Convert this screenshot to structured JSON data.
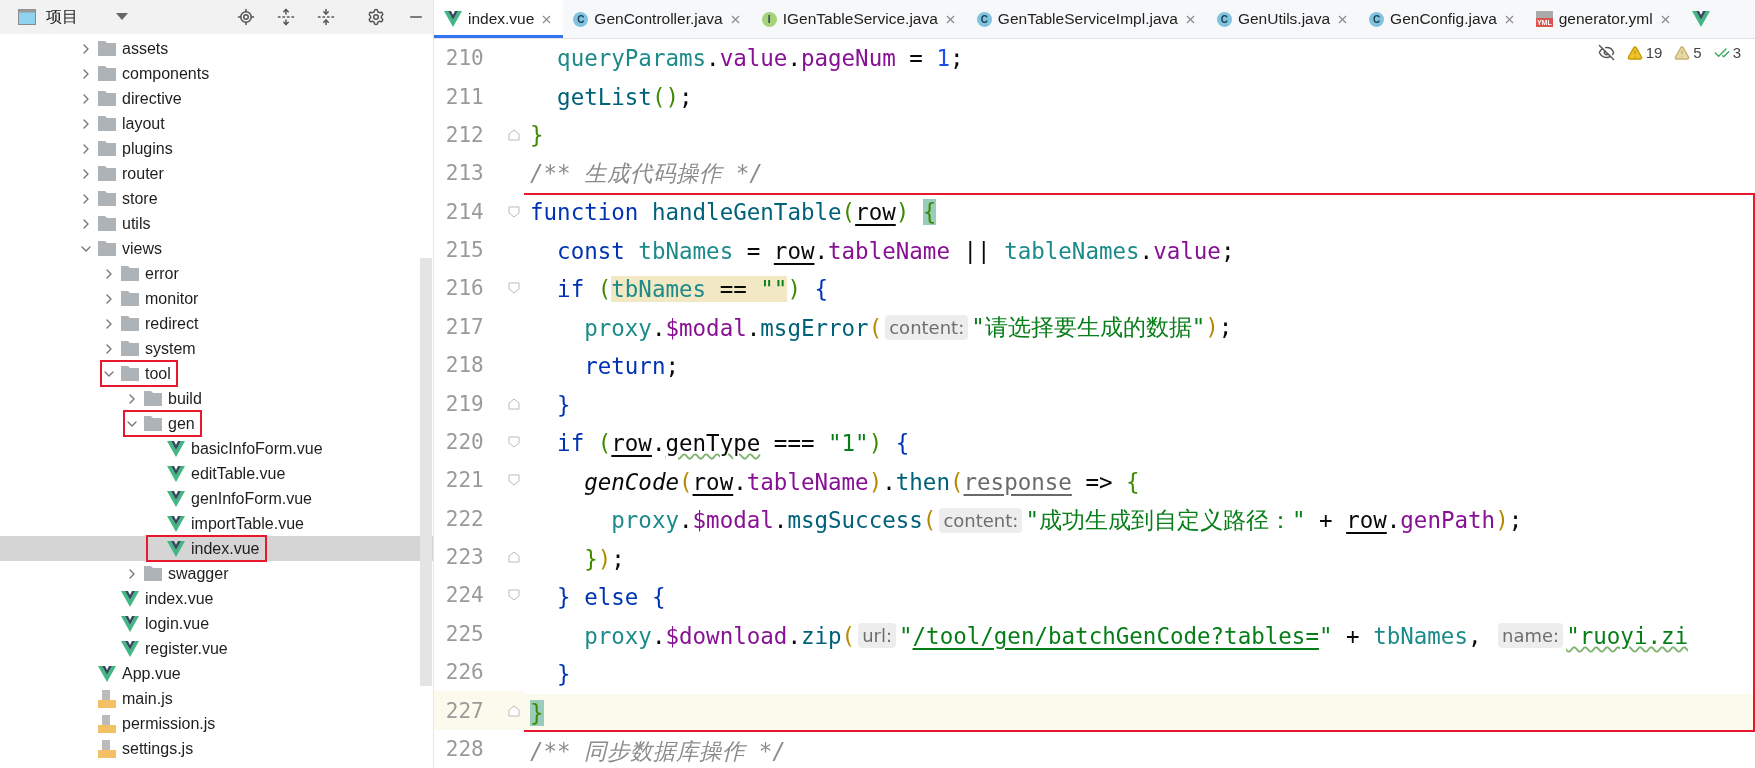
{
  "project_panel": {
    "title": "项目",
    "tree": [
      {
        "label": "assets",
        "kind": "folder",
        "expanded": false,
        "selected": false,
        "boxed": false
      },
      {
        "label": "components",
        "kind": "folder",
        "expanded": false,
        "selected": false,
        "boxed": false
      },
      {
        "label": "directive",
        "kind": "folder",
        "expanded": false,
        "selected": false,
        "boxed": false
      },
      {
        "label": "layout",
        "kind": "folder",
        "expanded": false,
        "selected": false,
        "boxed": false
      },
      {
        "label": "plugins",
        "kind": "folder",
        "expanded": false,
        "selected": false,
        "boxed": false
      },
      {
        "label": "router",
        "kind": "folder",
        "expanded": false,
        "selected": false,
        "boxed": false
      },
      {
        "label": "store",
        "kind": "folder",
        "expanded": false,
        "selected": false,
        "boxed": false
      },
      {
        "label": "utils",
        "kind": "folder",
        "expanded": false,
        "selected": false,
        "boxed": false
      },
      {
        "label": "views",
        "kind": "folder",
        "expanded": true,
        "selected": false,
        "boxed": false,
        "children": [
          {
            "label": "error",
            "kind": "folder",
            "expanded": false,
            "selected": false,
            "boxed": false
          },
          {
            "label": "monitor",
            "kind": "folder",
            "expanded": false,
            "selected": false,
            "boxed": false
          },
          {
            "label": "redirect",
            "kind": "folder",
            "expanded": false,
            "selected": false,
            "boxed": false
          },
          {
            "label": "system",
            "kind": "folder",
            "expanded": false,
            "selected": false,
            "boxed": false
          },
          {
            "label": "tool",
            "kind": "folder",
            "expanded": true,
            "selected": false,
            "boxed": true,
            "children": [
              {
                "label": "build",
                "kind": "folder",
                "expanded": false,
                "selected": false,
                "boxed": false
              },
              {
                "label": "gen",
                "kind": "folder",
                "expanded": true,
                "selected": false,
                "boxed": true,
                "children": [
                  {
                    "label": "basicInfoForm.vue",
                    "kind": "vue",
                    "selected": false,
                    "boxed": false
                  },
                  {
                    "label": "editTable.vue",
                    "kind": "vue",
                    "selected": false,
                    "boxed": false
                  },
                  {
                    "label": "genInfoForm.vue",
                    "kind": "vue",
                    "selected": false,
                    "boxed": false
                  },
                  {
                    "label": "importTable.vue",
                    "kind": "vue",
                    "selected": false,
                    "boxed": false
                  },
                  {
                    "label": "index.vue",
                    "kind": "vue",
                    "selected": true,
                    "boxed": true
                  }
                ]
              },
              {
                "label": "swagger",
                "kind": "folder",
                "expanded": false,
                "selected": false,
                "boxed": false
              }
            ]
          },
          {
            "label": "index.vue",
            "kind": "vue",
            "selected": false,
            "boxed": false
          },
          {
            "label": "login.vue",
            "kind": "vue",
            "selected": false,
            "boxed": false
          },
          {
            "label": "register.vue",
            "kind": "vue",
            "selected": false,
            "boxed": false
          }
        ]
      },
      {
        "label": "App.vue",
        "kind": "vue",
        "selected": false,
        "boxed": false
      },
      {
        "label": "main.js",
        "kind": "js",
        "selected": false,
        "boxed": false
      },
      {
        "label": "permission.js",
        "kind": "js",
        "selected": false,
        "boxed": false
      },
      {
        "label": "settings.js",
        "kind": "js",
        "selected": false,
        "boxed": false
      }
    ]
  },
  "editor": {
    "tabs": [
      {
        "label": "index.vue",
        "kind": "vue",
        "selected": true
      },
      {
        "label": "GenController.java",
        "kind": "class",
        "badge": "C",
        "selected": false
      },
      {
        "label": "IGenTableService.java",
        "kind": "interface",
        "badge": "I",
        "selected": false
      },
      {
        "label": "GenTableServiceImpl.java",
        "kind": "class",
        "badge": "C",
        "selected": false
      },
      {
        "label": "GenUtils.java",
        "kind": "class",
        "badge": "C",
        "selected": false
      },
      {
        "label": "GenConfig.java",
        "kind": "class",
        "badge": "C",
        "selected": false
      },
      {
        "label": "generator.yml",
        "kind": "yml",
        "badge": "YML",
        "selected": false
      },
      {
        "kind": "vue",
        "selected": false
      }
    ],
    "inspections": [
      {
        "kind": "warning",
        "count": "19"
      },
      {
        "kind": "weak",
        "count": "5"
      },
      {
        "kind": "typo",
        "count": "3"
      }
    ],
    "code_blocks": [
      {
        "boxed": false,
        "lines": [
          {
            "number": "210",
            "current": false,
            "fold_start": false,
            "fold_end": false,
            "tokens": [
              {
                "text": "  queryParams",
                "kind": "var"
              },
              {
                "text": ".",
                "kind": "plain"
              },
              {
                "text": "value",
                "kind": "prop"
              },
              {
                "text": ".",
                "kind": "plain"
              },
              {
                "text": "pageNum",
                "kind": "prop"
              },
              {
                "text": " = ",
                "kind": "plain"
              },
              {
                "text": "1",
                "kind": "number"
              },
              {
                "text": ";",
                "kind": "plain"
              }
            ]
          },
          {
            "number": "211",
            "current": false,
            "fold_start": false,
            "fold_end": false,
            "tokens": [
              {
                "text": "  getList",
                "kind": "func"
              },
              {
                "text": "()",
                "kind": "bracket1"
              },
              {
                "text": ";",
                "kind": "plain"
              }
            ]
          },
          {
            "number": "212",
            "current": false,
            "fold_start": false,
            "fold_end": true,
            "tokens": [
              {
                "text": "}",
                "kind": "bracket1"
              }
            ]
          },
          {
            "number": "213",
            "current": false,
            "fold_start": false,
            "fold_end": false,
            "tokens": [
              {
                "text": "/** 生成代码操作 */",
                "kind": "comment"
              }
            ]
          }
        ]
      },
      {
        "boxed": true,
        "lines": [
          {
            "number": "214",
            "current": false,
            "fold_start": true,
            "fold_end": false,
            "tokens": [
              {
                "text": "function",
                "kind": "keyword"
              },
              {
                "text": " handleGenTable",
                "kind": "func"
              },
              {
                "text": "(",
                "kind": "bracket1"
              },
              {
                "text": "row",
                "kind": "plain",
                "underlined": true
              },
              {
                "text": ") ",
                "kind": "bracket1"
              },
              {
                "text": "{",
                "kind": "bracket1",
                "brace_match": true
              }
            ]
          },
          {
            "number": "215",
            "current": false,
            "fold_start": false,
            "fold_end": false,
            "tokens": [
              {
                "text": "  const",
                "kind": "keyword"
              },
              {
                "text": " tbNames",
                "kind": "var"
              },
              {
                "text": " = ",
                "kind": "plain"
              },
              {
                "text": "row",
                "kind": "plain",
                "underlined": true
              },
              {
                "text": ".",
                "kind": "plain"
              },
              {
                "text": "tableName",
                "kind": "prop"
              },
              {
                "text": " || ",
                "kind": "plain"
              },
              {
                "text": "tableNames",
                "kind": "var"
              },
              {
                "text": ".",
                "kind": "plain"
              },
              {
                "text": "value",
                "kind": "prop"
              },
              {
                "text": ";",
                "kind": "plain"
              }
            ]
          },
          {
            "number": "216",
            "current": false,
            "fold_start": true,
            "fold_end": false,
            "tokens": [
              {
                "text": "  if",
                "kind": "keyword"
              },
              {
                "text": " (",
                "kind": "bracket1"
              },
              {
                "text": "tbNames",
                "kind": "var",
                "usage_highlight": true
              },
              {
                "text": " == ",
                "kind": "plain",
                "usage_highlight": true
              },
              {
                "text": "\"\"",
                "kind": "string",
                "usage_highlight": true
              },
              {
                "text": ")",
                "kind": "bracket1"
              },
              {
                "text": " {",
                "kind": "bracket3"
              }
            ]
          },
          {
            "number": "217",
            "current": false,
            "fold_start": false,
            "fold_end": false,
            "tokens": [
              {
                "text": "    proxy",
                "kind": "var"
              },
              {
                "text": ".",
                "kind": "plain"
              },
              {
                "text": "$modal",
                "kind": "prop"
              },
              {
                "text": ".",
                "kind": "plain"
              },
              {
                "text": "msgError",
                "kind": "func"
              },
              {
                "text": "(",
                "kind": "bracket2"
              },
              {
                "text": "content:",
                "kind": "hint"
              },
              {
                "text": "\"请选择要生成的数据\"",
                "kind": "string"
              },
              {
                "text": ")",
                "kind": "bracket2"
              },
              {
                "text": ";",
                "kind": "plain"
              }
            ]
          },
          {
            "number": "218",
            "current": false,
            "fold_start": false,
            "fold_end": false,
            "tokens": [
              {
                "text": "    return",
                "kind": "keyword"
              },
              {
                "text": ";",
                "kind": "plain"
              }
            ]
          },
          {
            "number": "219",
            "current": false,
            "fold_start": false,
            "fold_end": true,
            "tokens": [
              {
                "text": "  }",
                "kind": "bracket3"
              }
            ]
          },
          {
            "number": "220",
            "current": false,
            "fold_start": true,
            "fold_end": false,
            "tokens": [
              {
                "text": "  if",
                "kind": "keyword"
              },
              {
                "text": " (",
                "kind": "bracket1"
              },
              {
                "text": "row",
                "kind": "plain",
                "underlined": true
              },
              {
                "text": ".",
                "kind": "plain"
              },
              {
                "text": "genType",
                "kind": "plain",
                "wavy": true
              },
              {
                "text": " === ",
                "kind": "plain"
              },
              {
                "text": "\"1\"",
                "kind": "string"
              },
              {
                "text": ")",
                "kind": "bracket1"
              },
              {
                "text": " {",
                "kind": "bracket3"
              }
            ]
          },
          {
            "number": "221",
            "current": false,
            "fold_start": true,
            "fold_end": false,
            "tokens": [
              {
                "text": "    genCode",
                "kind": "imported"
              },
              {
                "text": "(",
                "kind": "bracket2"
              },
              {
                "text": "row",
                "kind": "plain",
                "underlined": true
              },
              {
                "text": ".",
                "kind": "plain"
              },
              {
                "text": "tableName",
                "kind": "prop"
              },
              {
                "text": ")",
                "kind": "bracket2"
              },
              {
                "text": ".",
                "kind": "plain"
              },
              {
                "text": "then",
                "kind": "func"
              },
              {
                "text": "(",
                "kind": "bracket2"
              },
              {
                "text": "response",
                "kind": "unused",
                "underlined": true
              },
              {
                "text": " => ",
                "kind": "plain"
              },
              {
                "text": "{",
                "kind": "bracket1"
              }
            ]
          },
          {
            "number": "222",
            "current": false,
            "fold_start": false,
            "fold_end": false,
            "tokens": [
              {
                "text": "      proxy",
                "kind": "var"
              },
              {
                "text": ".",
                "kind": "plain"
              },
              {
                "text": "$modal",
                "kind": "prop"
              },
              {
                "text": ".",
                "kind": "plain"
              },
              {
                "text": "msgSuccess",
                "kind": "func"
              },
              {
                "text": "(",
                "kind": "bracket2"
              },
              {
                "text": "content:",
                "kind": "hint"
              },
              {
                "text": "\"成功生成到自定义路径：\"",
                "kind": "string"
              },
              {
                "text": " + ",
                "kind": "plain"
              },
              {
                "text": "row",
                "kind": "plain",
                "underlined": true
              },
              {
                "text": ".",
                "kind": "plain"
              },
              {
                "text": "genPath",
                "kind": "prop"
              },
              {
                "text": ")",
                "kind": "bracket2"
              },
              {
                "text": ";",
                "kind": "plain"
              }
            ]
          },
          {
            "number": "223",
            "current": false,
            "fold_start": false,
            "fold_end": true,
            "tokens": [
              {
                "text": "    }",
                "kind": "bracket1"
              },
              {
                "text": ")",
                "kind": "bracket2"
              },
              {
                "text": ";",
                "kind": "plain"
              }
            ]
          },
          {
            "number": "224",
            "current": false,
            "fold_start": true,
            "fold_end": false,
            "tokens": [
              {
                "text": "  }",
                "kind": "bracket3"
              },
              {
                "text": " else",
                "kind": "keyword"
              },
              {
                "text": " {",
                "kind": "bracket3"
              }
            ]
          },
          {
            "number": "225",
            "current": false,
            "fold_start": false,
            "fold_end": false,
            "tokens": [
              {
                "text": "    proxy",
                "kind": "var"
              },
              {
                "text": ".",
                "kind": "plain"
              },
              {
                "text": "$download",
                "kind": "prop"
              },
              {
                "text": ".",
                "kind": "plain"
              },
              {
                "text": "zip",
                "kind": "func"
              },
              {
                "text": "(",
                "kind": "bracket2"
              },
              {
                "text": "url:",
                "kind": "hint"
              },
              {
                "text": "\"",
                "kind": "string"
              },
              {
                "text": "/tool/gen/batchGenCode?tables=",
                "kind": "string",
                "underlined": true
              },
              {
                "text": "\"",
                "kind": "string"
              },
              {
                "text": " + ",
                "kind": "plain"
              },
              {
                "text": "tbNames",
                "kind": "var"
              },
              {
                "text": ", ",
                "kind": "plain"
              },
              {
                "text": "name:",
                "kind": "hint"
              },
              {
                "text": "\"ruoyi.zi",
                "kind": "string",
                "wavy": true
              }
            ]
          },
          {
            "number": "226",
            "current": false,
            "fold_start": false,
            "fold_end": false,
            "tokens": [
              {
                "text": "  }",
                "kind": "bracket3"
              }
            ]
          },
          {
            "number": "227",
            "current": true,
            "fold_start": false,
            "fold_end": true,
            "tokens": [
              {
                "text": "}",
                "kind": "bracket1",
                "brace_match": true
              }
            ]
          }
        ]
      },
      {
        "boxed": false,
        "lines": [
          {
            "number": "228",
            "current": false,
            "fold_start": false,
            "fold_end": false,
            "tokens": [
              {
                "text": "/** 同步数据库操作 */",
                "kind": "comment"
              }
            ]
          }
        ]
      }
    ]
  }
}
